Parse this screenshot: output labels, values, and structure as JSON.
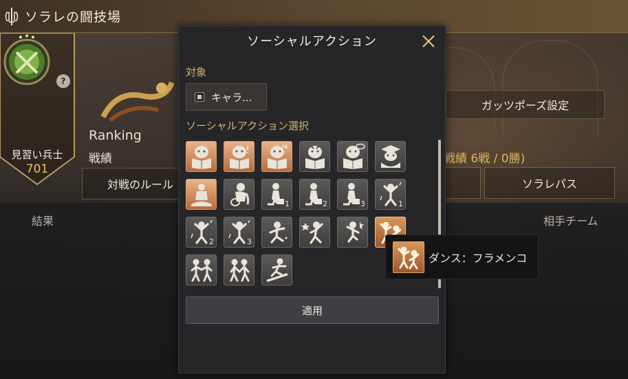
{
  "window": {
    "title": "ソラレの闘技場"
  },
  "player": {
    "rank_name": "見習い兵士",
    "rank_points": "701",
    "help_symbol": "?"
  },
  "overview": {
    "ranking_label": "Ranking",
    "record_label": "戦績",
    "record_value": "戦績 6戦 / 0勝)",
    "rule_button": "対戦のルール",
    "guts_pose_button": "ガッツポーズ設定",
    "solare_pass_button": "ソラレパス",
    "result_label": "結果",
    "opponent_label": "相手チーム"
  },
  "dialog": {
    "title": "ソーシャルアクション",
    "target_label": "対象",
    "target_button": "キャラ...",
    "action_select_label": "ソーシャルアクション選択",
    "apply_button": "適用",
    "actions": [
      {
        "icon": "book-reading-icon",
        "style": "orange",
        "sub": ""
      },
      {
        "icon": "book-surprised-icon",
        "style": "orange",
        "sub": ""
      },
      {
        "icon": "book-shout-icon",
        "style": "orange",
        "sub": ""
      },
      {
        "icon": "book-angry-icon",
        "style": "gray",
        "sub": ""
      },
      {
        "icon": "book-thinking-icon",
        "style": "gray",
        "sub": ""
      },
      {
        "icon": "graduation-icon",
        "style": "gray",
        "sub": ""
      },
      {
        "icon": "meditate-icon",
        "style": "orange",
        "sub": ""
      },
      {
        "icon": "sit-wave-icon",
        "style": "gray",
        "sub": ""
      },
      {
        "icon": "kneel-icon",
        "style": "gray",
        "sub": "1"
      },
      {
        "icon": "kneel-icon",
        "style": "gray",
        "sub": "2"
      },
      {
        "icon": "kneel-icon",
        "style": "gray",
        "sub": "3"
      },
      {
        "icon": "dance-icon",
        "style": "gray",
        "sub": "1"
      },
      {
        "icon": "dance-icon",
        "style": "gray",
        "sub": "2"
      },
      {
        "icon": "dance-icon",
        "style": "gray",
        "sub": "3"
      },
      {
        "icon": "dance-spin-icon",
        "style": "gray",
        "sub": ""
      },
      {
        "icon": "dance-star-icon",
        "style": "gray",
        "sub": ""
      },
      {
        "icon": "dance-jump-icon",
        "style": "gray",
        "sub": ""
      },
      {
        "icon": "dance-flamenco-icon",
        "style": "selected",
        "sub": ""
      },
      {
        "icon": "pair-dance-icon",
        "style": "gray",
        "sub": ""
      },
      {
        "icon": "pair-walk-icon",
        "style": "gray",
        "sub": ""
      },
      {
        "icon": "surf-icon",
        "style": "gray",
        "sub": ""
      }
    ]
  },
  "tooltip": {
    "text": "ダンス：フラメンコ",
    "icon": "dance-flamenco-icon"
  }
}
